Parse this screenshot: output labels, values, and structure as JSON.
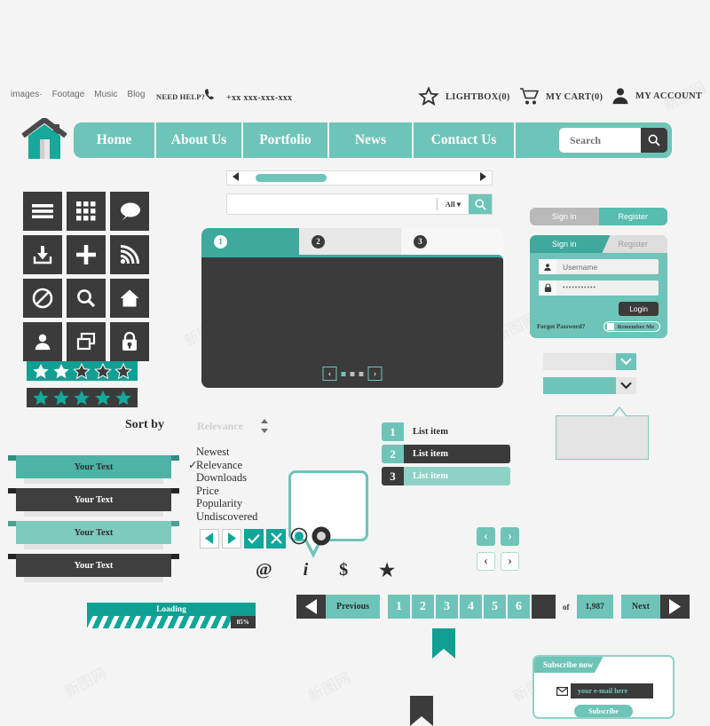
{
  "topbar": {
    "links": [
      "images·",
      "Footage",
      "Music",
      "Blog"
    ],
    "need_help": "NEED HELP?",
    "phone": "+xx xxx-xxx-xxx",
    "phone_icon": "phone-icon",
    "account_items": [
      {
        "icon": "star-icon",
        "label": "LIGHTBOX(0)"
      },
      {
        "icon": "cart-icon",
        "label": "MY CART(0)"
      },
      {
        "icon": "user-icon",
        "label": "MY ACCOUNT"
      }
    ]
  },
  "nav": {
    "logo_icon": "home-logo-icon",
    "items": [
      "Home",
      "About Us",
      "Portfolio",
      "News",
      "Contact Us"
    ],
    "search_placeholder": "Search",
    "search_value": "",
    "search_icon": "search-icon"
  },
  "scrollbar": {
    "left_icon": "arrow-left-icon",
    "right_icon": "arrow-right-icon",
    "thumb_pct": 27
  },
  "searchrow": {
    "value": "",
    "placeholder": "",
    "scope_label": "All ▾",
    "go_icon": "search-icon"
  },
  "icon_grid": [
    "hamburger-menu-icon",
    "grid-icon",
    "chat-bubble-icon",
    "download-icon",
    "plus-icon",
    "rss-icon",
    "no-entry-icon",
    "search-icon",
    "home-icon",
    "user-icon",
    "windows-icon",
    "lock-icon"
  ],
  "ratings": [
    {
      "style": "teal",
      "filled": 2,
      "total": 5
    },
    {
      "style": "dark",
      "filled": 5,
      "total": 5
    }
  ],
  "slider": {
    "tabs": [
      "1",
      "2",
      "3"
    ],
    "active_tab": 0,
    "prev_icon": "chevron-left-icon",
    "next_icon": "chevron-right-icon",
    "dots": 3,
    "active_dot": 0
  },
  "signin_tabs": {
    "left": "Sign in",
    "right": "Register"
  },
  "login": {
    "tab_active": "Sign in",
    "tab_inactive": "Register",
    "username_icon": "user-icon",
    "username_value": "Username",
    "password_icon": "lock-icon",
    "password_value": "•••••••••••",
    "login_button": "Login",
    "forgot": "Forgot Password?",
    "remember": "Remember Me"
  },
  "selects": [
    {
      "style": "grey-body-teal-caret",
      "value": "",
      "caret_icon": "chevron-down-icon"
    },
    {
      "style": "teal-body-grey-caret",
      "value": "",
      "caret_icon": "chevron-down-icon"
    }
  ],
  "tooltip": {
    "text": ""
  },
  "speech_bubble": {
    "text": ""
  },
  "sort": {
    "label": "Sort by",
    "value": "Relevance",
    "stepper_icon": "up-down-arrows-icon",
    "options": [
      "Newest",
      "Relevance",
      "Downloads",
      "Price",
      "Popularity",
      "Undiscovered"
    ],
    "selected": "Relevance",
    "check_mark": "✓"
  },
  "ribbons": [
    {
      "text": "Your Text",
      "style": "teal-dark"
    },
    {
      "text": "Your Text",
      "style": "charcoal"
    },
    {
      "text": "Your Text",
      "style": "teal-light"
    },
    {
      "text": "Your Text",
      "style": "charcoal"
    }
  ],
  "list_items": [
    {
      "num": "1",
      "text": "List item",
      "num_bg": "#6ec4b8",
      "body_bg": "transparent",
      "text_color": "#2e2e2e"
    },
    {
      "num": "2",
      "text": "List item",
      "num_bg": "#6ec4b8",
      "body_bg": "#3b3b3b",
      "text_color": "#ffffff"
    },
    {
      "num": "3",
      "text": "List item",
      "num_bg": "#3b3b3b",
      "body_bg": "#8ed2c6",
      "text_color": "#ffffff"
    }
  ],
  "control_buttons": [
    {
      "icon": "triangle-left-icon",
      "style": "outline"
    },
    {
      "icon": "triangle-right-icon",
      "style": "outline"
    },
    {
      "icon": "check-icon",
      "style": "teal"
    },
    {
      "icon": "close-x-icon",
      "style": "teal"
    },
    {
      "icon": "radio-selected-icon",
      "style": "radio-teal"
    },
    {
      "icon": "radio-dark-icon",
      "style": "radio-dark"
    }
  ],
  "glyphs": [
    {
      "icon": "at-sign-icon",
      "char": "@"
    },
    {
      "icon": "info-icon",
      "char": "i"
    },
    {
      "icon": "dollar-icon",
      "char": "$"
    },
    {
      "icon": "star-icon",
      "char": "★"
    }
  ],
  "bookmarks": [
    {
      "icon": "bookmark-icon",
      "color": "#0fa093"
    },
    {
      "icon": "bookmark-icon",
      "color": "#3b3b3b"
    }
  ],
  "chevron_nav": [
    {
      "icon": "chevron-left-icon",
      "style": "filled"
    },
    {
      "icon": "chevron-right-icon",
      "style": "filled"
    },
    {
      "icon": "chevron-left-icon",
      "style": "hollow"
    },
    {
      "icon": "chevron-right-icon",
      "style": "hollow"
    }
  ],
  "subscribe": {
    "title": "Subscribe now",
    "envelope_icon": "envelope-icon",
    "email_placeholder": "your e-mail here",
    "button": "Subscribe"
  },
  "loading": {
    "label": "Loading",
    "percent": "85%",
    "value": 85
  },
  "pagination": {
    "prev_arrow_icon": "triangle-left-icon",
    "prev_label": "Previous",
    "pages": [
      "1",
      "2",
      "3",
      "4",
      "5",
      "6"
    ],
    "of_label": "of",
    "total": "1,987",
    "next_label": "Next",
    "next_arrow_icon": "triangle-right-icon"
  },
  "colors": {
    "teal": "#6ec4b8",
    "teal_dark": "#0fa093",
    "teal_mid": "#3fa99d",
    "teal_light": "#8ed2c6",
    "charcoal": "#3b3b3b",
    "bg": "#f4f4f4"
  }
}
